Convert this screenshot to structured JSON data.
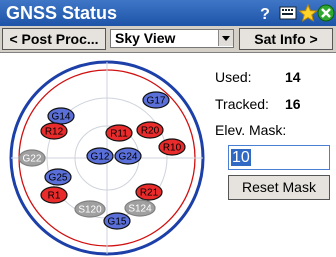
{
  "title": "GNSS Status",
  "toolbar": {
    "prev_label": "< Post Proc...",
    "view_selected": "Sky View",
    "next_label": "Sat Info >"
  },
  "stats": {
    "used_label": "Used:",
    "used_value": "14",
    "tracked_label": "Tracked:",
    "tracked_value": "16",
    "elev_mask_label": "Elev. Mask:",
    "elev_mask_value": "10",
    "reset_label": "Reset Mask"
  },
  "colors": {
    "used": "#5a6fd8",
    "used_alt": "#ea2b2b",
    "unused": "#a0a0a0",
    "mask": "#cc0000"
  },
  "icons": [
    "help-icon",
    "keyboard-icon",
    "favorites-icon",
    "close-icon"
  ],
  "satellites": [
    {
      "label": "G17",
      "color": "blue"
    },
    {
      "label": "G14",
      "color": "blue"
    },
    {
      "label": "R12",
      "color": "red"
    },
    {
      "label": "R11",
      "color": "red"
    },
    {
      "label": "R20",
      "color": "red"
    },
    {
      "label": "R10",
      "color": "red"
    },
    {
      "label": "G22",
      "color": "gray"
    },
    {
      "label": "G12",
      "color": "blue"
    },
    {
      "label": "G24",
      "color": "blue"
    },
    {
      "label": "G25",
      "color": "blue"
    },
    {
      "label": "R21",
      "color": "red"
    },
    {
      "label": "R1",
      "color": "red"
    },
    {
      "label": "S120",
      "color": "gray"
    },
    {
      "label": "S124",
      "color": "gray"
    },
    {
      "label": "G15",
      "color": "blue"
    }
  ]
}
